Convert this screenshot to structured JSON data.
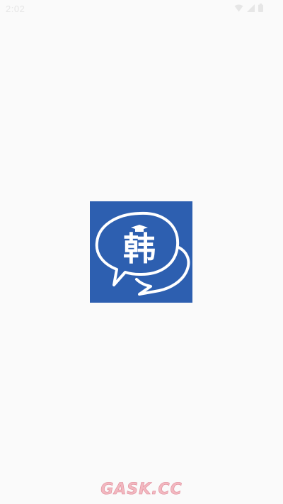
{
  "status_bar": {
    "time": "2:02",
    "icons": [
      "wifi-icon",
      "cellular-signal-icon",
      "battery-icon"
    ],
    "text_color": "#e6e6e6"
  },
  "splash": {
    "logo_character": "韩",
    "background_color": "#2d5fb0",
    "foreground_color": "#ffffff"
  },
  "watermark": {
    "text": "GASK.CC",
    "color": "#f2b8c0"
  }
}
